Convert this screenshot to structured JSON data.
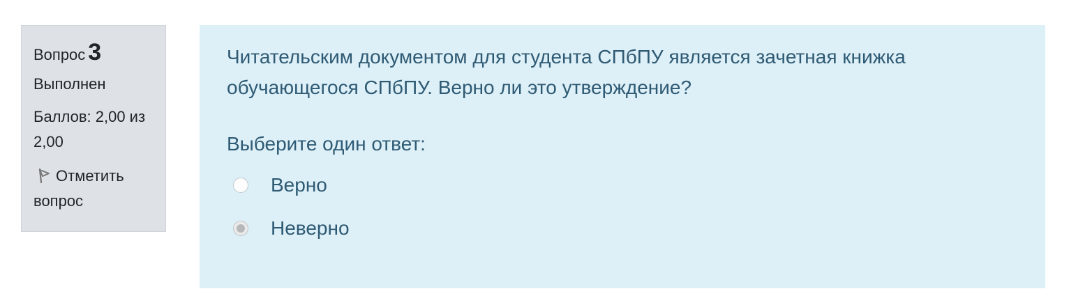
{
  "info": {
    "question_label": "Вопрос",
    "question_number": "3",
    "state": "Выполнен",
    "grade": "Баллов: 2,00 из 2,00",
    "flag_label": "Отметить вопрос"
  },
  "content": {
    "question_text": "Читательским документом для студента СПбПУ является зачетная книжка обучающегося СПбПУ. Верно ли это утверждение?",
    "prompt": "Выберите один ответ:",
    "options": [
      {
        "label": "Верно",
        "selected": false
      },
      {
        "label": "Неверно",
        "selected": true
      }
    ]
  },
  "colors": {
    "info_background": "#dee2e6",
    "content_background": "#def0f7",
    "content_text": "#2e5a74"
  },
  "icons": {
    "flag": "flag-icon"
  }
}
